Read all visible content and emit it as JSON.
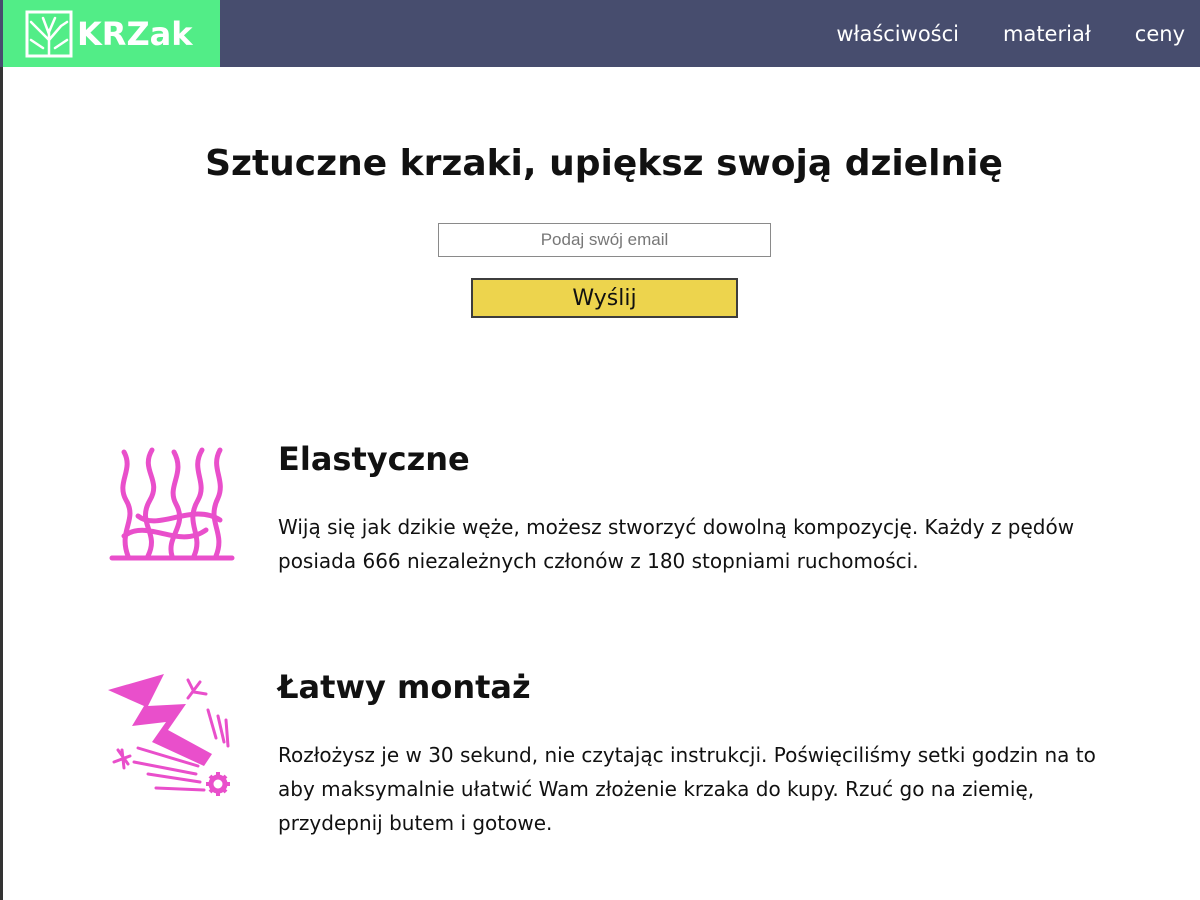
{
  "brand": {
    "name": "KRZak",
    "logo_icon": "branch-icon",
    "colors": {
      "logo_bg": "#52ed87",
      "header_bg": "#474d6e",
      "accent": "#e94fcb",
      "button_bg": "#edd44d"
    }
  },
  "nav": {
    "items": [
      {
        "label": "właściwości"
      },
      {
        "label": "materiał"
      },
      {
        "label": "ceny"
      }
    ]
  },
  "hero": {
    "title": "Sztuczne krzaki, upiększ swoją dzielnię",
    "email_placeholder": "Podaj swój email",
    "email_value": "",
    "submit_label": "Wyślij"
  },
  "features": [
    {
      "icon": "tangled-strands-icon",
      "title": "Elastyczne",
      "description": "Wiją się jak dzikie węże, możesz stworzyć dowolną kompozycję. Każdy z pędów posiada 666 niezależnych członów z 180 stopniami ruchomości."
    },
    {
      "icon": "lightning-bolt-icon",
      "title": "Łatwy montaż",
      "description": "Rozłożysz je w 30 sekund, nie czytając instrukcji. Poświęciliśmy setki godzin na to aby maksymalnie ułatwić Wam złożenie krzaka do kupy. Rzuć go na ziemię, przydepnij butem i gotowe."
    }
  ]
}
